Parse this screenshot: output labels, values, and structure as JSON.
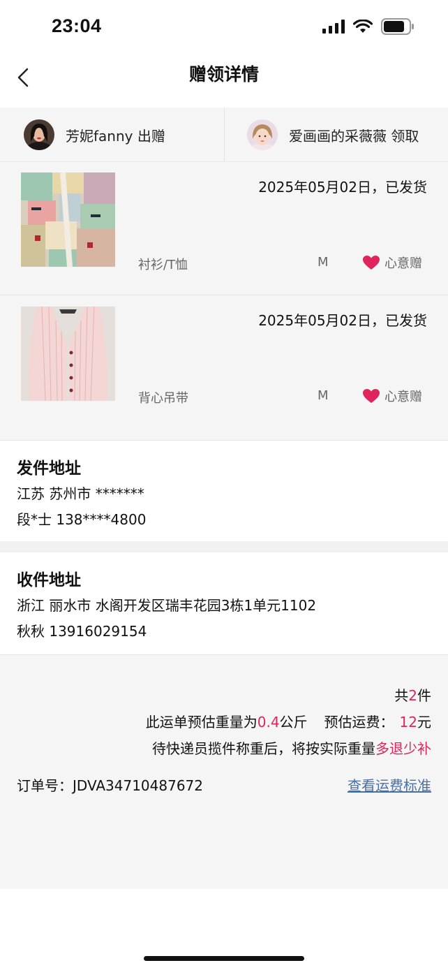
{
  "status_bar": {
    "time": "23:04"
  },
  "header": {
    "title": "赠领详情"
  },
  "parties": {
    "giver": {
      "name": "芳妮fanny 出赠"
    },
    "receiver": {
      "name": "爱画画的采薇薇 领取"
    }
  },
  "items": [
    {
      "date_status": "2025年05月02日，已发货",
      "category": "衬衫/T恤",
      "size": "M",
      "tag": "心意赠"
    },
    {
      "date_status": "2025年05月02日，已发货",
      "category": "背心吊带",
      "size": "M",
      "tag": "心意赠"
    }
  ],
  "sender_address": {
    "title": "发件地址",
    "line1": "江苏 苏州市 *******",
    "line2": "段*士 138****4800"
  },
  "receiver_address": {
    "title": "收件地址",
    "line1": "浙江 丽水市 水阁开发区瑞丰花园3栋1单元1102",
    "line2": "秋秋 13916029154"
  },
  "summary": {
    "count_prefix": "共",
    "count": "2",
    "count_suffix": "件",
    "weight_prefix": "此运单预估重量为",
    "weight": "0.4",
    "weight_unit": "公斤",
    "fee_label": "预估运费：",
    "fee": "12",
    "fee_unit": "元",
    "note_prefix": "待快递员揽件称重后，将按实际重量",
    "note_highlight": "多退少补",
    "order_label": "订单号：",
    "order_number": "JDVA34710487672",
    "fee_standard_link": "查看运费标准"
  },
  "colors": {
    "accent_red": "#e0245e",
    "link_blue": "#4a6fa5",
    "section_gray": "#f5f5f5"
  }
}
